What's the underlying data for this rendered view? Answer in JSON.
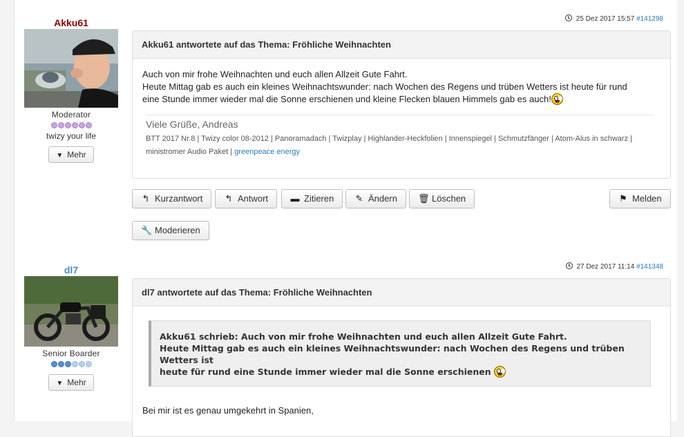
{
  "posts": [
    {
      "user": {
        "name": "Akku61",
        "rank": "Moderator",
        "motto": "twizy your life",
        "more_label": "Mehr",
        "dot_color": "#c7a6e0"
      },
      "meta": {
        "date": "25 Dez 2017 15:57",
        "id": "#141298"
      },
      "title": "Akku61 antwortete auf das Thema: Fröhliche Weihnachten",
      "body_lines": [
        "Auch von mir frohe Weihnachten und euch allen Allzeit Gute Fahrt.",
        "Heute Mittag gab es auch ein kleines Weihnachtswunder: nach Wochen des Regens und trüben Wetters ist heute für rund",
        "eine Stunde immer wieder mal die Sonne erschienen und kleine Flecken blauen Himmels gab es auch!"
      ],
      "signature": {
        "greeting": "Viele Grüße, Andreas",
        "line1": "BTT 2017 Nr.8 | Twizy color 08-2012 | Panoramadach | Twizplay | Highlander-Heckfolien | Innenspiegel | Schmutzfänger | Atom-Alus in schwarz |",
        "line2_text": "ministromer Audio Paket | ",
        "line2_link": "greenpeace energy"
      },
      "buttons": {
        "quick_reply": "Kurzantwort",
        "reply": "Antwort",
        "quote": "Zitieren",
        "edit": "Ändern",
        "delete": "Löschen",
        "report": "Melden",
        "moderate": "Moderieren"
      }
    },
    {
      "user": {
        "name": "dl7",
        "rank": "Senior Boarder",
        "more_label": "Mehr",
        "dot_color": "#5a8fd0"
      },
      "meta": {
        "date": "27 Dez 2017 11:14",
        "id": "#141348"
      },
      "title": "dl7 antwortete auf das Thema: Fröhliche Weihnachten",
      "quote_lines": [
        "Akku61 schrieb: Auch von mir frohe Weihnachten und euch allen Allzeit Gute Fahrt.",
        "Heute Mittag gab es auch ein kleines Weihnachtswunder: nach Wochen des Regens und trüben Wetters ist",
        "heute für rund eine Stunde immer wieder mal die Sonne erschienen"
      ],
      "body_text": "Bei mir ist es genau umgekehrt in Spanien,"
    }
  ]
}
